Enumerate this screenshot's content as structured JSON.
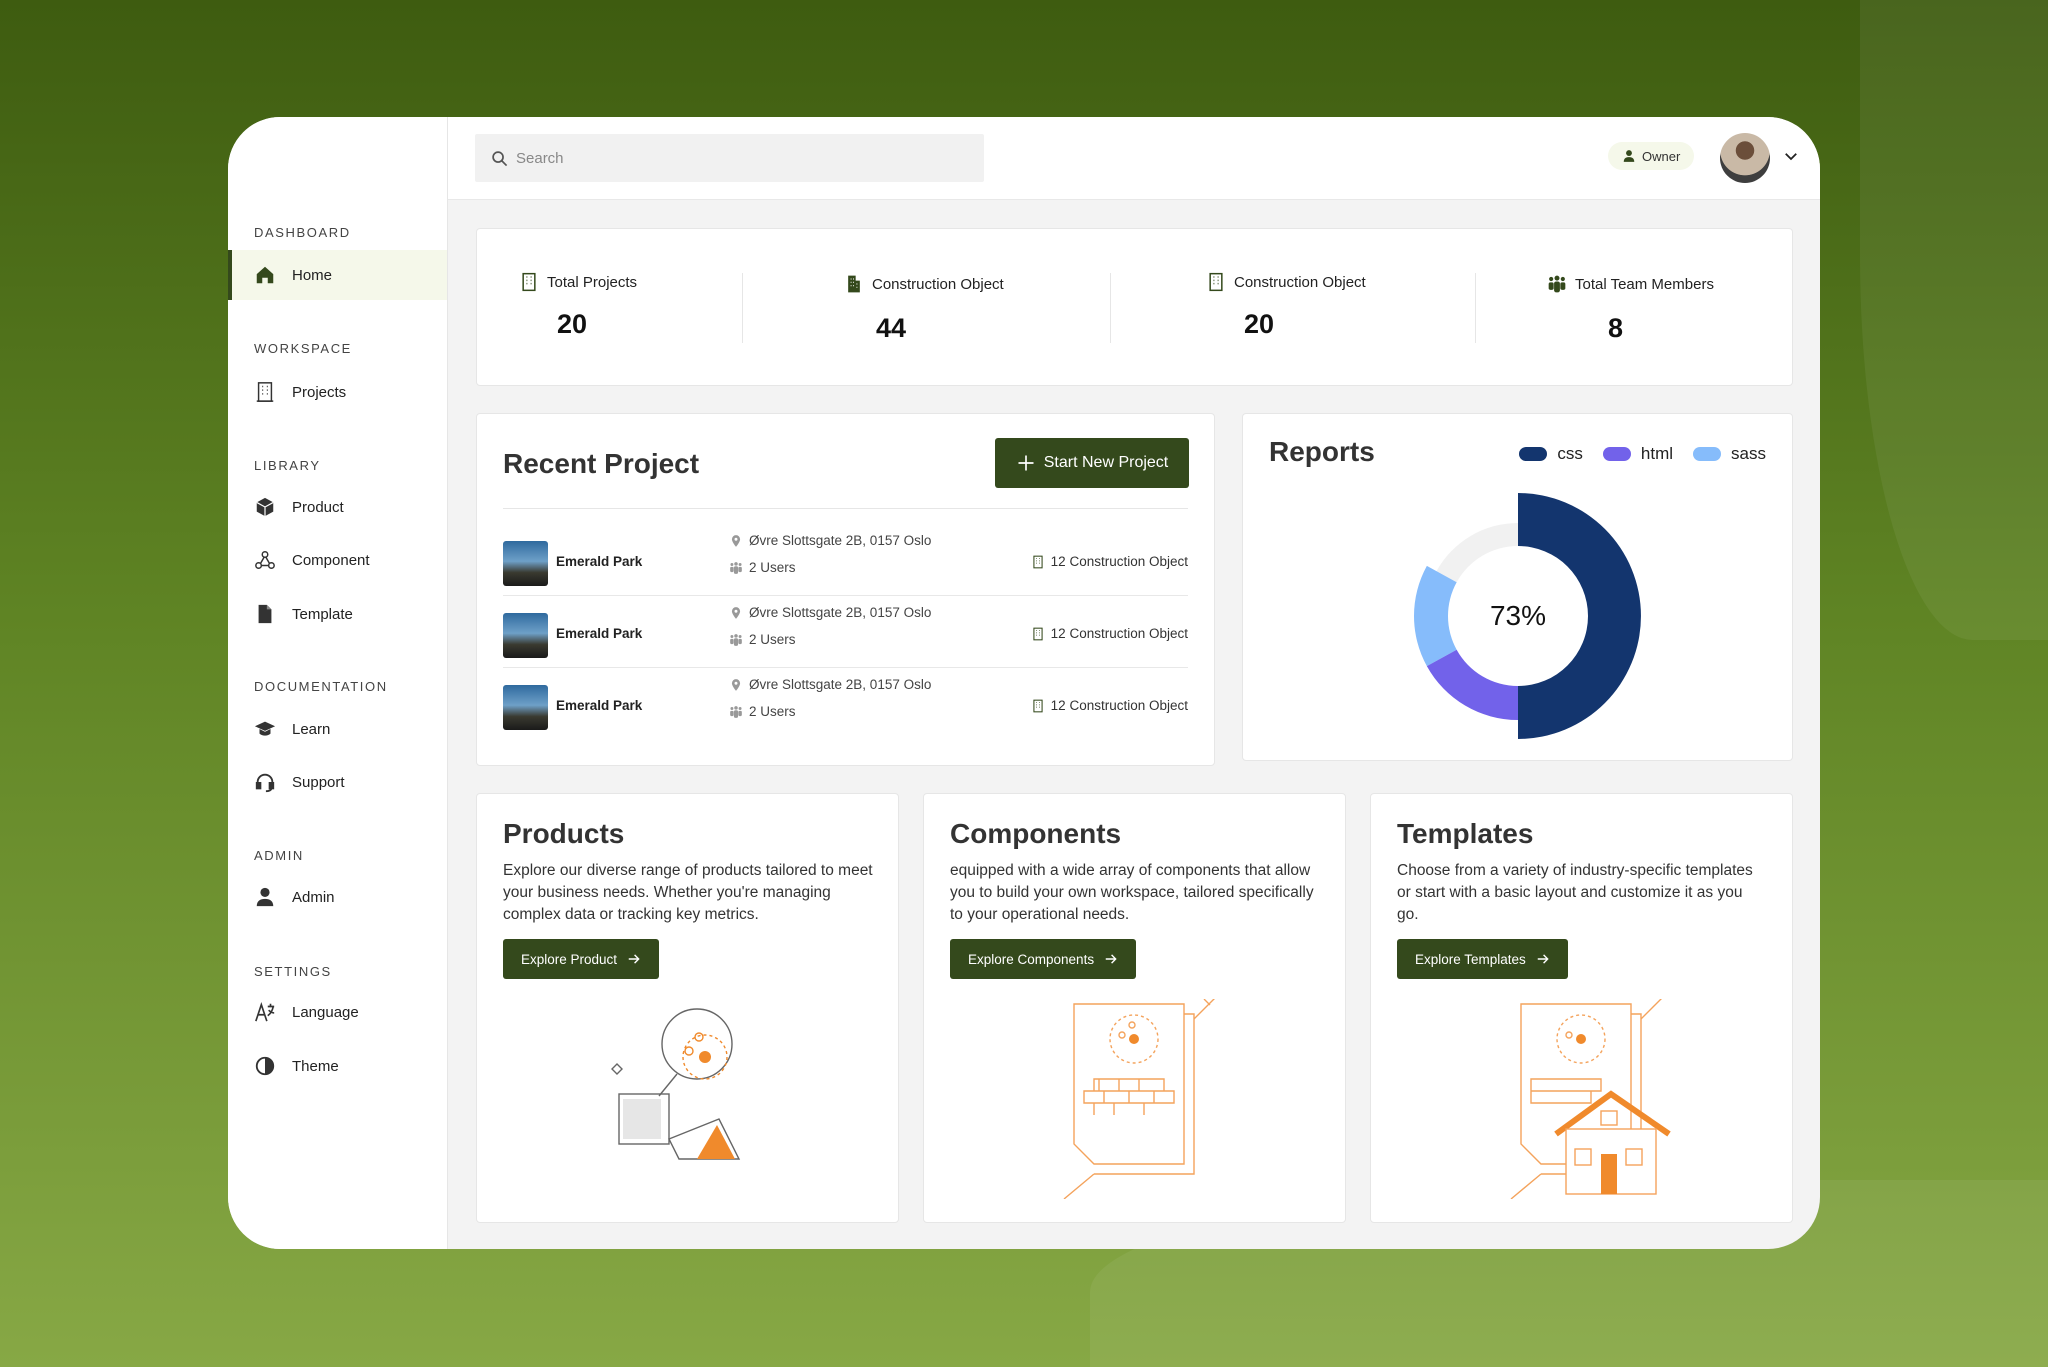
{
  "search": {
    "placeholder": "Search"
  },
  "user": {
    "role": "Owner"
  },
  "sidebar": {
    "sections": [
      {
        "label": "DASHBOARD",
        "items": [
          {
            "label": "Home",
            "icon": "home-icon",
            "active": true
          }
        ]
      },
      {
        "label": "WORKSPACE",
        "items": [
          {
            "label": "Projects",
            "icon": "building-icon"
          }
        ]
      },
      {
        "label": "LIBRARY",
        "items": [
          {
            "label": "Product",
            "icon": "box-icon"
          },
          {
            "label": "Component",
            "icon": "component-icon"
          },
          {
            "label": "Template",
            "icon": "file-icon"
          }
        ]
      },
      {
        "label": "DOCUMENTATION",
        "items": [
          {
            "label": "Learn",
            "icon": "graduation-cap-icon"
          },
          {
            "label": "Support",
            "icon": "headset-icon"
          }
        ]
      },
      {
        "label": "ADMIN",
        "items": [
          {
            "label": "Admin",
            "icon": "user-icon"
          }
        ]
      },
      {
        "label": "SETTINGS",
        "items": [
          {
            "label": "Language",
            "icon": "language-icon"
          },
          {
            "label": "Theme",
            "icon": "theme-icon"
          }
        ]
      }
    ]
  },
  "stats": [
    {
      "label": "Total Projects",
      "value": "20"
    },
    {
      "label": "Construction Object",
      "value": "44"
    },
    {
      "label": "Construction Object",
      "value": "20"
    },
    {
      "label": "Total Team Members",
      "value": "8"
    }
  ],
  "recent": {
    "title": "Recent Project",
    "button": "Start New Project",
    "rows": [
      {
        "name": "Emerald Park",
        "address": "Øvre Slottsgate 2B, 0157 Oslo",
        "users": "2 Users",
        "objects": "12 Construction Object"
      },
      {
        "name": "Emerald Park",
        "address": "Øvre Slottsgate 2B, 0157 Oslo",
        "users": "2 Users",
        "objects": "12 Construction Object"
      },
      {
        "name": "Emerald Park",
        "address": "Øvre Slottsgate 2B, 0157 Oslo",
        "users": "2 Users",
        "objects": "12 Construction Object"
      }
    ]
  },
  "reports": {
    "title": "Reports",
    "center_label": "73%"
  },
  "chart_data": {
    "type": "pie",
    "title": "Reports",
    "series": [
      {
        "name": "css",
        "value": 50,
        "color": "#13356e"
      },
      {
        "name": "html",
        "value": 17,
        "color": "#7262ea"
      },
      {
        "name": "sass",
        "value": 16,
        "color": "#86bcfb"
      }
    ],
    "remainder": 17,
    "center_label": "73%",
    "legend": "top-right"
  },
  "cards": [
    {
      "title": "Products",
      "text": "Explore our diverse range of products tailored to meet your business needs. Whether you're managing complex data or tracking key metrics.",
      "button": "Explore Product"
    },
    {
      "title": "Components",
      "text": "equipped with a wide array of components that allow you to build your own workspace, tailored specifically to your operational needs.",
      "button": "Explore Components"
    },
    {
      "title": "Templates",
      "text": "Choose from a variety of industry-specific templates or start with a basic layout and customize it as you go.",
      "button": "Explore Templates"
    }
  ]
}
